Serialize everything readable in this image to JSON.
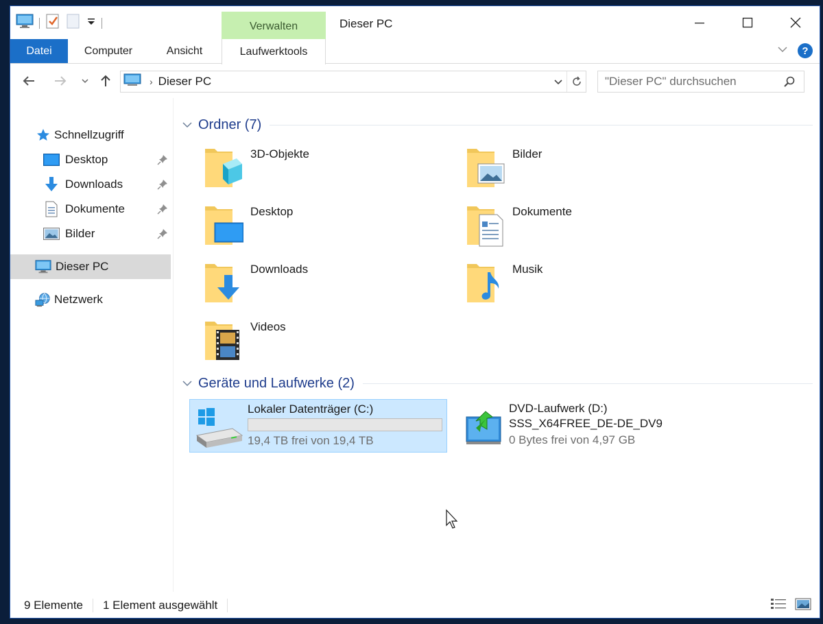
{
  "window": {
    "title": "Dieser PC",
    "context_group": "Verwalten"
  },
  "ribbon": {
    "tabs": {
      "file": "Datei",
      "computer": "Computer",
      "view": "Ansicht",
      "drive_tools": "Laufwerktools"
    },
    "help_label": "?"
  },
  "address": {
    "path": "Dieser PC",
    "separator": "›"
  },
  "search": {
    "placeholder": "\"Dieser PC\" durchsuchen"
  },
  "sidebar": {
    "quick_access": "Schnellzugriff",
    "pinned": [
      {
        "label": "Desktop",
        "icon": "desktop-icon"
      },
      {
        "label": "Downloads",
        "icon": "downloads-icon"
      },
      {
        "label": "Dokumente",
        "icon": "documents-icon"
      },
      {
        "label": "Bilder",
        "icon": "pictures-icon"
      }
    ],
    "this_pc": "Dieser PC",
    "network": "Netzwerk"
  },
  "groups": {
    "folders": {
      "title": "Ordner (7)",
      "items": [
        "3D-Objekte",
        "Bilder",
        "Desktop",
        "Dokumente",
        "Downloads",
        "Musik",
        "Videos"
      ]
    },
    "devices": {
      "title": "Geräte und Laufwerke (2)",
      "drives": [
        {
          "name": "Lokaler Datenträger (C:)",
          "free": "19,4 TB frei von 19,4 TB",
          "used_fraction": 0.0
        },
        {
          "name": "DVD-Laufwerk (D:)",
          "label": "SSS_X64FREE_DE-DE_DV9",
          "free": "0 Bytes frei von 4,97 GB"
        }
      ]
    }
  },
  "status": {
    "count": "9 Elemente",
    "selection": "1 Element ausgewählt"
  },
  "colors": {
    "accent": "#1b6fc8",
    "context_tab": "#c6efb0",
    "group_title": "#1e3c8c",
    "selection": "#cce8ff"
  }
}
